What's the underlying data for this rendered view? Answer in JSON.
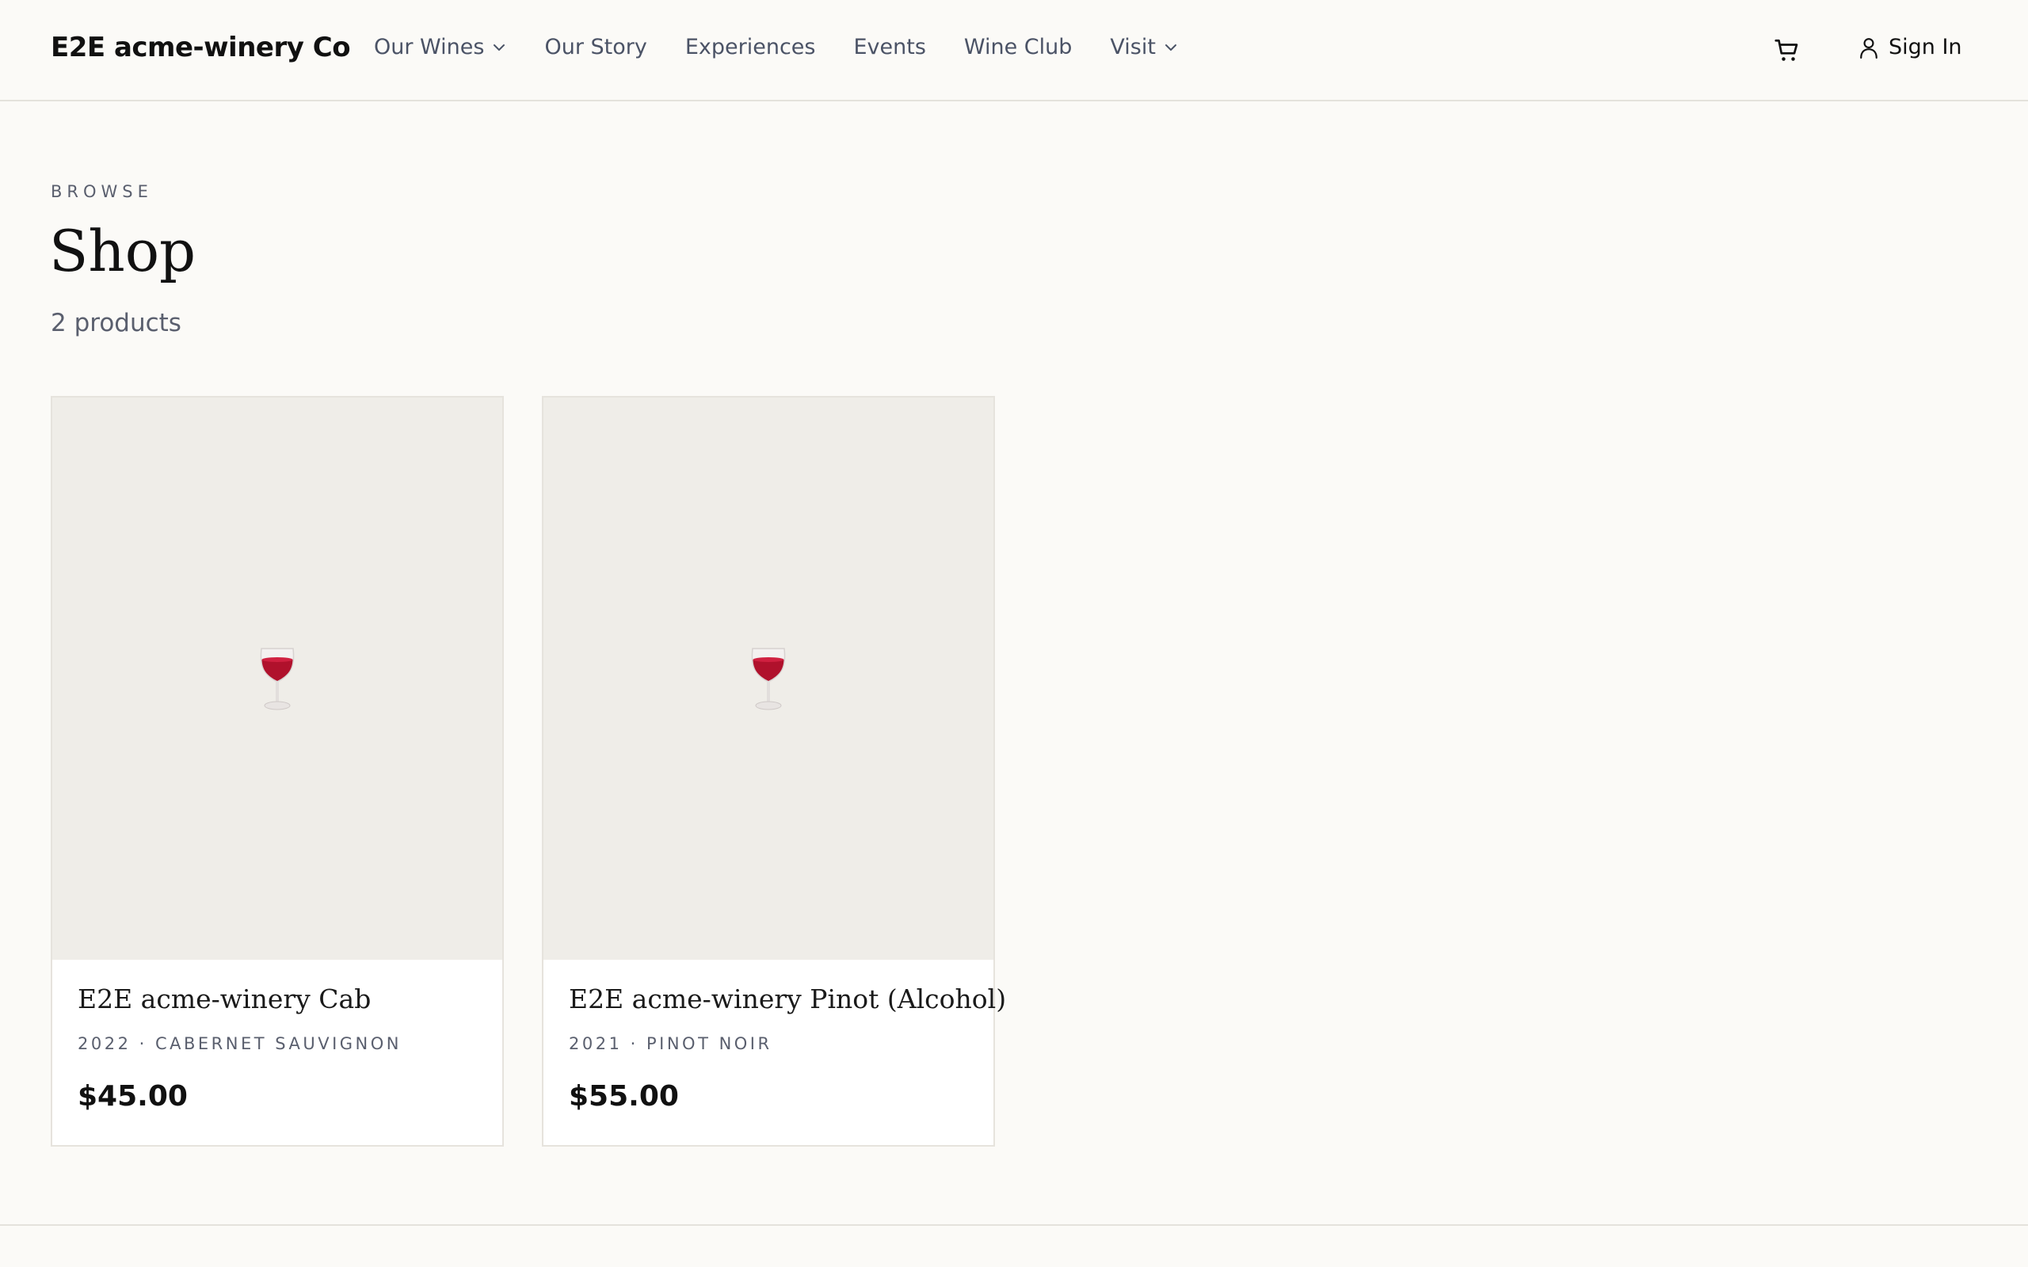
{
  "header": {
    "brand": "E2E acme-winery Co",
    "nav": [
      {
        "label": "Our Wines",
        "has_dropdown": true
      },
      {
        "label": "Our Story",
        "has_dropdown": false
      },
      {
        "label": "Experiences",
        "has_dropdown": false
      },
      {
        "label": "Events",
        "has_dropdown": false
      },
      {
        "label": "Wine Club",
        "has_dropdown": false
      },
      {
        "label": "Visit",
        "has_dropdown": true
      }
    ],
    "cart_icon": "shopping-cart-icon",
    "signin_label": "Sign In",
    "signin_icon": "user-icon"
  },
  "page": {
    "eyebrow": "BROWSE",
    "title": "Shop",
    "count": "2 products"
  },
  "products": [
    {
      "name": "E2E acme-winery Cab",
      "meta": "2022 · CABERNET SAUVIGNON",
      "price": "$45.00",
      "icon": "wine-glass-icon"
    },
    {
      "name": "E2E acme-winery Pinot (Alcohol)",
      "meta": "2021 · PINOT NOIR",
      "price": "$55.00",
      "icon": "wine-glass-icon"
    }
  ],
  "colors": {
    "background": "#fbfaf7",
    "image_placeholder": "#efede8",
    "text": "#111111",
    "muted": "#5a5f6e",
    "wine": "#b0112c"
  }
}
